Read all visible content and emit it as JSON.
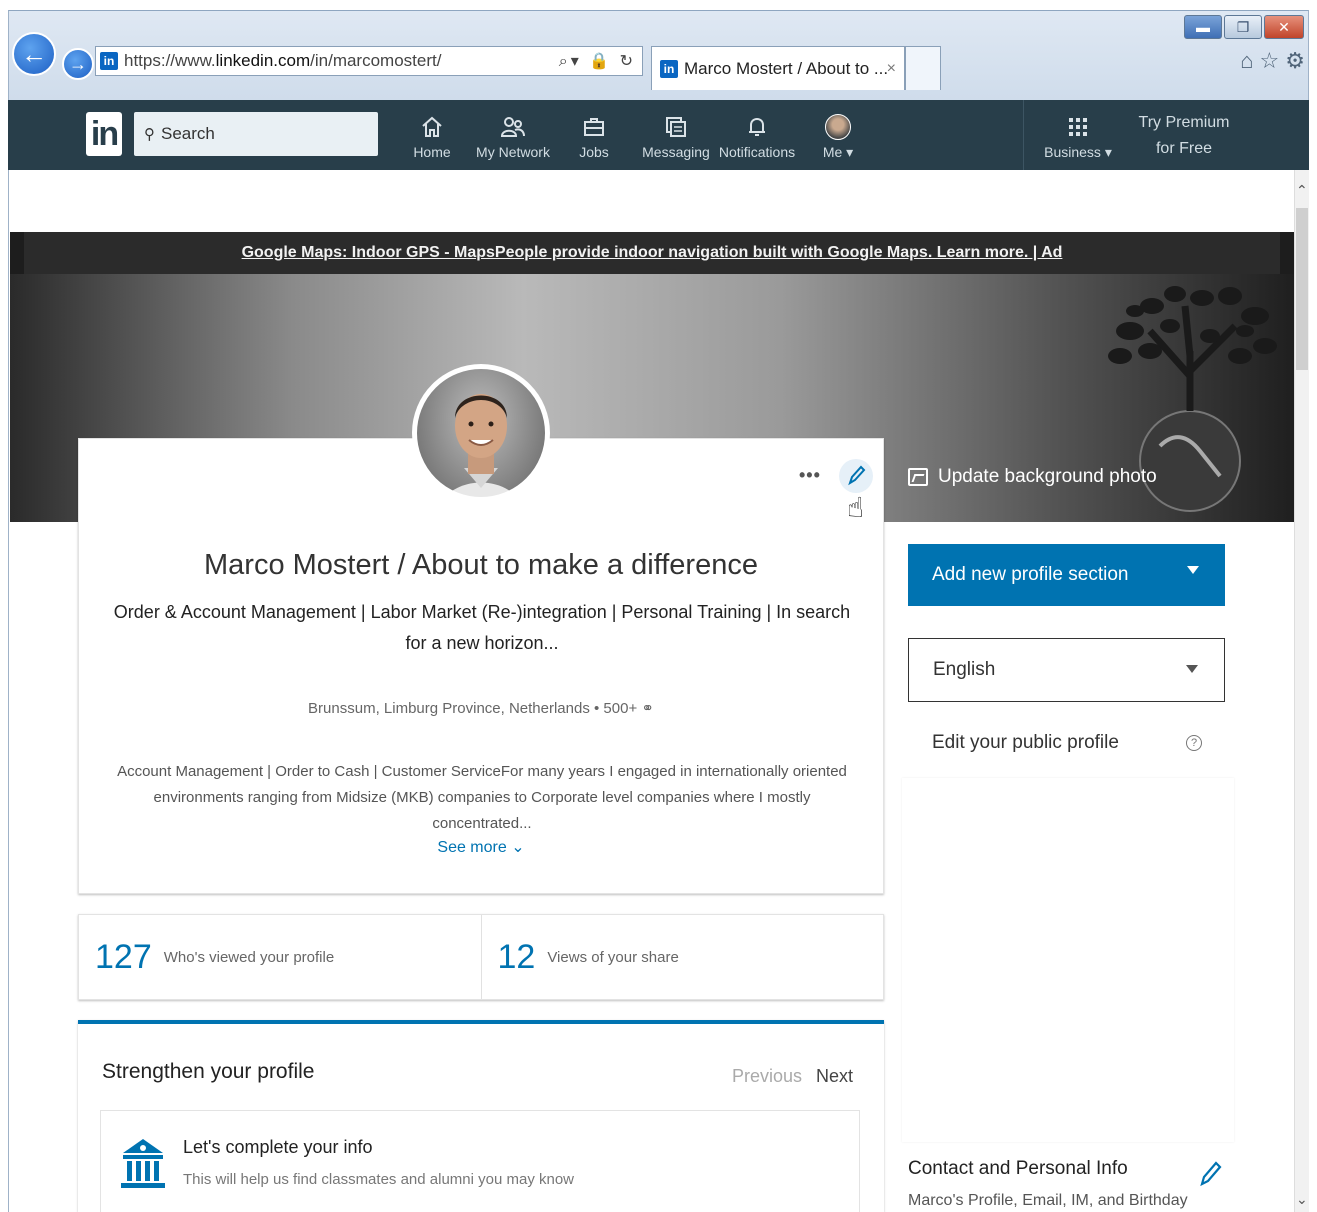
{
  "browser": {
    "url_prefix": "https://www.",
    "url_host": "linkedin.com",
    "url_path": "/in/marcomostert/",
    "tab_title": "Marco Mostert / About to ...",
    "tab_close": "×",
    "favicon_text": "in"
  },
  "nav": {
    "logo": "in",
    "search_placeholder": "Search",
    "items": [
      {
        "label": "Home",
        "icon": "home-icon"
      },
      {
        "label": "My Network",
        "icon": "network-icon"
      },
      {
        "label": "Jobs",
        "icon": "briefcase-icon"
      },
      {
        "label": "Messaging",
        "icon": "messaging-icon"
      },
      {
        "label": "Notifications",
        "icon": "bell-icon"
      },
      {
        "label": "Me ▾",
        "icon": "avatar"
      }
    ],
    "business": "Business ▾",
    "premium_line1": "Try Premium",
    "premium_line2": "for Free"
  },
  "banner": {
    "ad_text": "Google Maps: Indoor GPS - MapsPeople provide indoor navigation built with Google Maps. Learn more. | Ad",
    "update_bg": "Update background photo"
  },
  "profile": {
    "more_dots": "•••",
    "name": "Marco Mostert / About to make a difference",
    "headline": "Order & Account Management | Labor Market (Re-)integration | Personal Training | In search for a new horizon...",
    "location": "Brunssum, Limburg Province, Netherlands • 500+ ⚭",
    "summary": "Account Management | Order to Cash | Customer ServiceFor many years I engaged in internationally oriented environments ranging from Midsize (MKB) companies to Corporate level companies where I mostly concentrated...",
    "see_more": "See more ⌄"
  },
  "stats": [
    {
      "num": "127",
      "label": "Who's viewed your profile"
    },
    {
      "num": "12",
      "label": "Views of your share"
    }
  ],
  "strengthen": {
    "title": "Strengthen your profile",
    "previous": "Previous",
    "next": "Next",
    "card_title": "Let's complete your info",
    "card_sub": "This will help us find classmates and alumni you may know"
  },
  "sidebar": {
    "add_section": "Add new profile section",
    "language": "English",
    "public_profile": "Edit your public profile",
    "help": "?",
    "contact_title": "Contact and Personal Info",
    "contact_sub": "Marco's Profile, Email, IM, and Birthday"
  },
  "colors": {
    "linkedin_blue": "#0073b1",
    "nav_bg": "#283e4a"
  }
}
